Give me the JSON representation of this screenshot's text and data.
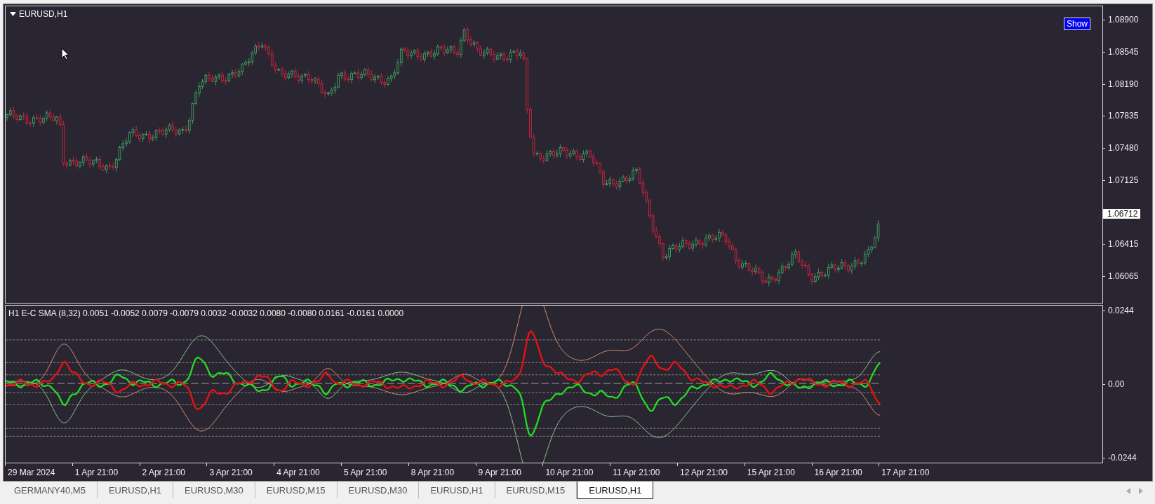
{
  "chart": {
    "title": "EURUSD,H1",
    "show_button": "Show",
    "price_axis": [
      {
        "kind": "tick",
        "label": "1.08900"
      },
      {
        "kind": "tick",
        "label": "1.08545"
      },
      {
        "kind": "tick",
        "label": "1.08190"
      },
      {
        "kind": "tick",
        "label": "1.07835"
      },
      {
        "kind": "tick",
        "label": "1.07480"
      },
      {
        "kind": "tick",
        "label": "1.07125"
      },
      {
        "kind": "current",
        "label": "1.06712"
      },
      {
        "kind": "tick",
        "label": "1.06415"
      },
      {
        "kind": "tick",
        "label": "1.06065"
      }
    ]
  },
  "indicator": {
    "title": "H1 E-C SMA (8,32) 0.0051 -0.0052 0.0079 -0.0079 0.0032 -0.0032 0.0080 -0.0080 0.0161 -0.0161 0.0000",
    "axis": [
      "0.0244",
      "0.00",
      "-0.0244"
    ]
  },
  "time_axis": [
    "29 Mar 2024",
    "1 Apr 21:00",
    "2 Apr 21:00",
    "3 Apr 21:00",
    "4 Apr 21:00",
    "5 Apr 21:00",
    "8 Apr 21:00",
    "9 Apr 21:00",
    "10 Apr 21:00",
    "11 Apr 21:00",
    "12 Apr 21:00",
    "15 Apr 21:00",
    "16 Apr 21:00",
    "17 Apr 21:00"
  ],
  "tabs": [
    {
      "label": "GERMANY40,M5",
      "selected": false
    },
    {
      "label": "EURUSD,H1",
      "selected": false
    },
    {
      "label": "EURUSD,M30",
      "selected": false
    },
    {
      "label": "EURUSD,M15",
      "selected": false
    },
    {
      "label": "EURUSD,M30",
      "selected": false
    },
    {
      "label": "EURUSD,H1",
      "selected": false
    },
    {
      "label": "EURUSD,M15",
      "selected": false
    },
    {
      "label": "EURUSD,H1",
      "selected": true
    }
  ]
}
